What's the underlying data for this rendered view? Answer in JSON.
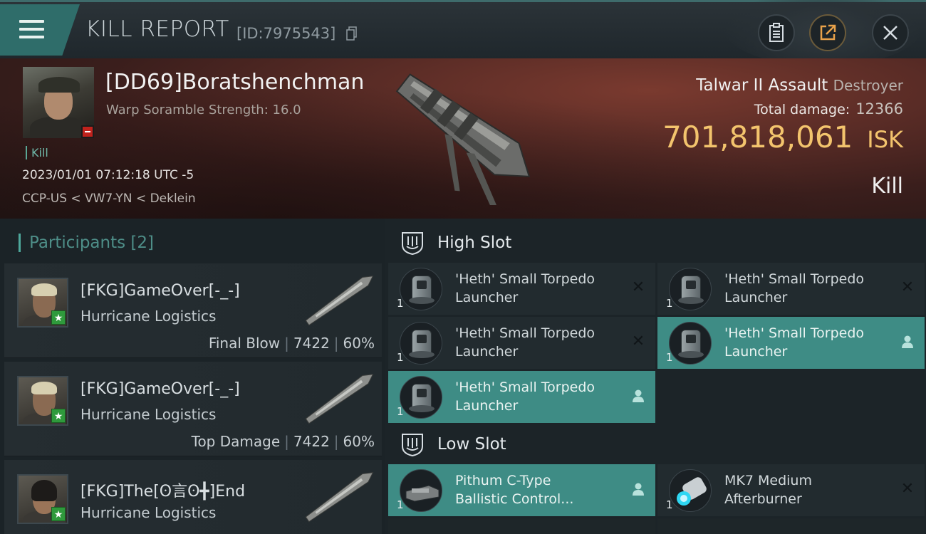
{
  "header": {
    "title": "KILL REPORT",
    "kill_id": "[ID:7975543]",
    "menu_icon": "hamburger-menu-icon",
    "buttons": [
      {
        "name": "clipboard-button",
        "icon": "clipboard-icon"
      },
      {
        "name": "share-button",
        "icon": "share-icon"
      },
      {
        "name": "close-button",
        "icon": "close-icon"
      }
    ]
  },
  "victim": {
    "name": "[DD69]Boratshenchman",
    "scramble": "Warp Soramble Strength: 16.0",
    "tag": "Kill",
    "time": "2023/01/01 07:12:18 UTC -5",
    "location": "CCP-US < VW7-YN < Deklein",
    "ship_name": "Talwar II Assault",
    "ship_class": "Destroyer",
    "total_damage_label": "Total damage:",
    "total_damage": "12366",
    "isk_value": "701,818,061",
    "isk_unit": "ISK",
    "result": "Kill"
  },
  "participants": {
    "title": "Participants",
    "count": "[2]",
    "items": [
      {
        "name": "[FKG]GameOver[-_-]",
        "ship": "Hurricane Logistics",
        "role": "Final Blow",
        "damage": "7422",
        "percent": "60%"
      },
      {
        "name": "[FKG]GameOver[-_-]",
        "ship": "Hurricane Logistics",
        "role": "Top Damage",
        "damage": "7422",
        "percent": "60%"
      },
      {
        "name": "[FKG]The[ʘ言ʘ╋]End",
        "ship": "Hurricane Logistics"
      }
    ]
  },
  "slots": {
    "high": {
      "label": "High Slot",
      "modules": [
        {
          "name_line1": "'Heth' Small Torpedo",
          "name_line2": "Launcher",
          "qty": "1",
          "state": "destroyed"
        },
        {
          "name_line1": "'Heth' Small Torpedo",
          "name_line2": "Launcher",
          "qty": "1",
          "state": "destroyed"
        },
        {
          "name_line1": "'Heth' Small Torpedo",
          "name_line2": "Launcher",
          "qty": "1",
          "state": "destroyed"
        },
        {
          "name_line1": "'Heth' Small Torpedo",
          "name_line2": "Launcher",
          "qty": "1",
          "state": "dropped"
        },
        {
          "name_line1": "'Heth' Small Torpedo",
          "name_line2": "Launcher",
          "qty": "1",
          "state": "dropped"
        }
      ]
    },
    "low": {
      "label": "Low Slot",
      "modules": [
        {
          "name_line1": "Pithum C-Type",
          "name_line2": "Ballistic Control...",
          "qty": "1",
          "state": "dropped"
        },
        {
          "name_line1": "MK7 Medium",
          "name_line2": "Afterburner",
          "qty": "1",
          "state": "destroyed"
        }
      ]
    }
  },
  "colors": {
    "accent": "#3e8c85",
    "isk": "#f3c46d",
    "participants_title": "#4e8e88",
    "badge_green": "#2f9a3c",
    "badge_red": "#c0221c"
  }
}
